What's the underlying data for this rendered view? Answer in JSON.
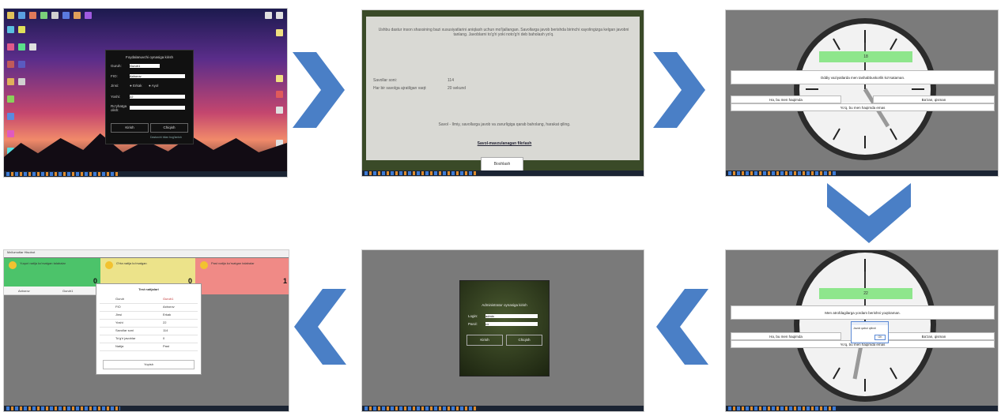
{
  "shot1": {
    "dialog_title": "Foydalanuvchi oynasiga kirish",
    "fields": [
      {
        "label": "Guruh:",
        "value": "Guruh1"
      },
      {
        "label": "FIO:",
        "value": "Axborov"
      },
      {
        "label": "Jinsi:",
        "value": ""
      },
      {
        "label": "Yoshi:",
        "value": "22"
      },
      {
        "label": "Ro'yhatga olish:",
        "value": ""
      }
    ],
    "gender_options": [
      "Erkak",
      "Ayol"
    ],
    "enter_button": "Kirish",
    "exit_button": "Chiqish",
    "footer_link": "Dasturchi bilan bog'lanish"
  },
  "shot2": {
    "instructions": "Ushbu dastur inson shaxsining bazi xususiyatlarini aniqlash uchun mo'ljallangan. Savollarga javob berishda birinchi xayolingizga kelgan javobni tanlang. Javoblarni to'g'ri yoki noto'g'ri deb baholash yo'q.",
    "stats": [
      {
        "label": "Savollar soni:",
        "value": "114"
      },
      {
        "label": "Har bir savolga ajratilgan vaqt:",
        "value": "20 sekund"
      }
    ],
    "prompt": "Savol - Ilmiy, savollarga javob va zarurligiga qarab baholang, harakat qiling.",
    "link": "Savol-mavzulanagan fikrlash",
    "ok_button": "Boshlash"
  },
  "shot3": {
    "counter": "18",
    "question": "Oddiy vaziyatlarda men tashabbuskorlik ko'rsataman.",
    "answers": [
      "Ha, bu men haqimda",
      "Ba'zan, qisman",
      "Yo'q, bu men haqimda emas"
    ]
  },
  "shot6": {
    "counter": "22",
    "question": "Men atrofdagilarga yordam berishni yoqtiraman.",
    "answers": [
      "Ha, bu men haqimda",
      "Ba'zan, qisman",
      "Yo'q, bu men haqimda emas"
    ],
    "popup_text": "Javob qabul qilindi",
    "popup_button": "OK"
  },
  "shot5": {
    "title": "Administrator oynasiga kirish",
    "login_label": "Login:",
    "login_value": "admin",
    "password_label": "Parol:",
    "password_value": "•••",
    "enter_button": "Kirish",
    "exit_button": "Chiqish"
  },
  "shot4": {
    "menu": "Ma'lumotlar   Hisobot",
    "columns": [
      {
        "title": "Yuqori natija ko'rsatgan talabalar",
        "count": "0",
        "color": "#4cc36a"
      },
      {
        "title": "O'rta natija ko'rsatgan",
        "count": "0",
        "color": "#ece38a"
      },
      {
        "title": "Past natija ko'rsatgan talabalar",
        "count": "1",
        "color": "#f08a86"
      }
    ],
    "dialog_title": "Test natijalari",
    "dialog_rows": [
      {
        "k": "Guruh",
        "v": "Guruh1"
      },
      {
        "k": "FIO",
        "v": "Axborov"
      },
      {
        "k": "Jinsi",
        "v": "Erkak"
      },
      {
        "k": "Yoshi",
        "v": "22"
      },
      {
        "k": "Savollar soni",
        "v": "114"
      },
      {
        "k": "To'g'ri javoblar",
        "v": "0"
      },
      {
        "k": "Natija",
        "v": "Past"
      }
    ],
    "dialog_button": "Yopish",
    "row_name": "Axborov",
    "row_group": "Guruh1"
  }
}
